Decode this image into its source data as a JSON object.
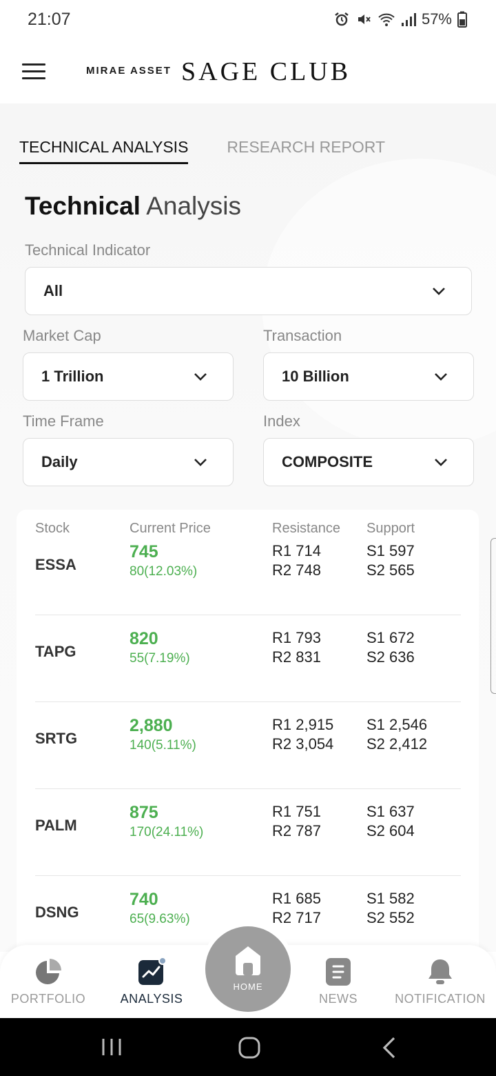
{
  "status": {
    "time": "21:07",
    "battery": "57%"
  },
  "header": {
    "brand_small": "MIRAE ASSET",
    "brand_large": "SAGE CLUB"
  },
  "tabs": [
    {
      "label": "TECHNICAL ANALYSIS",
      "active": true
    },
    {
      "label": "RESEARCH REPORT",
      "active": false
    }
  ],
  "title": {
    "bold": "Technical",
    "light": "Analysis"
  },
  "filters": {
    "technical_indicator": {
      "label": "Technical Indicator",
      "value": "All"
    },
    "market_cap": {
      "label": "Market Cap",
      "value": "1 Trillion"
    },
    "transaction": {
      "label": "Transaction",
      "value": "10 Billion"
    },
    "time_frame": {
      "label": "Time Frame",
      "value": "Daily"
    },
    "index": {
      "label": "Index",
      "value": "COMPOSITE"
    }
  },
  "table": {
    "headers": {
      "stock": "Stock",
      "price": "Current Price",
      "resistance": "Resistance",
      "support": "Support"
    },
    "rows": [
      {
        "code": "ESSA",
        "price": "745",
        "change": "80(12.03%)",
        "r1": "R1 714",
        "r2": "R2 748",
        "s1": "S1 597",
        "s2": "S2 565"
      },
      {
        "code": "TAPG",
        "price": "820",
        "change": "55(7.19%)",
        "r1": "R1 793",
        "r2": "R2 831",
        "s1": "S1 672",
        "s2": "S2 636"
      },
      {
        "code": "SRTG",
        "price": "2,880",
        "change": "140(5.11%)",
        "r1": "R1 2,915",
        "r2": "R2 3,054",
        "s1": "S1 2,546",
        "s2": "S2 2,412"
      },
      {
        "code": "PALM",
        "price": "875",
        "change": "170(24.11%)",
        "r1": "R1 751",
        "r2": "R2 787",
        "s1": "S1 637",
        "s2": "S2 604"
      },
      {
        "code": "DSNG",
        "price": "740",
        "change": "65(9.63%)",
        "r1": "R1 685",
        "r2": "R2 717",
        "s1": "S1 582",
        "s2": "S2 552"
      }
    ]
  },
  "bottom_nav": {
    "portfolio": "PORTFOLIO",
    "analysis": "ANALYSIS",
    "home": "HOME",
    "news": "NEWS",
    "notification": "NOTIFICATION"
  },
  "colors": {
    "positive": "#4caf50",
    "accent_dark": "#1b2a3a",
    "home_button": "#9e9e9e"
  }
}
